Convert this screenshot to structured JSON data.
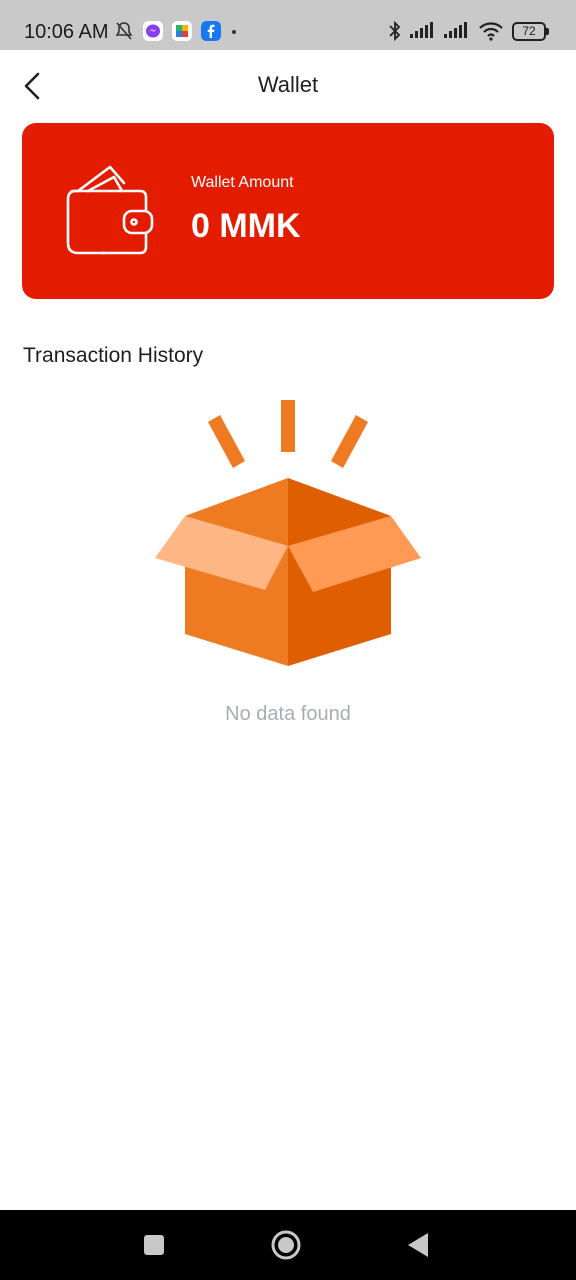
{
  "status_bar": {
    "time": "10:06 AM",
    "battery": "72",
    "left_icons": [
      "bell-off-icon",
      "messenger-icon",
      "app-icon",
      "facebook-icon",
      "dot-icon"
    ],
    "right_icons": [
      "bluetooth-icon",
      "signal-icon",
      "signal-icon",
      "wifi-icon",
      "battery-icon"
    ]
  },
  "header": {
    "title": "Wallet",
    "back_icon": "back-arrow-icon"
  },
  "wallet_card": {
    "label": "Wallet Amount",
    "amount": "0 MMK",
    "icon": "wallet-icon",
    "color": "#e31c00"
  },
  "transactions": {
    "title": "Transaction History",
    "empty_text": "No data found",
    "empty_icon": "empty-box-icon"
  },
  "nav_bar": {
    "buttons": [
      "recents-button",
      "home-button",
      "back-button"
    ]
  }
}
